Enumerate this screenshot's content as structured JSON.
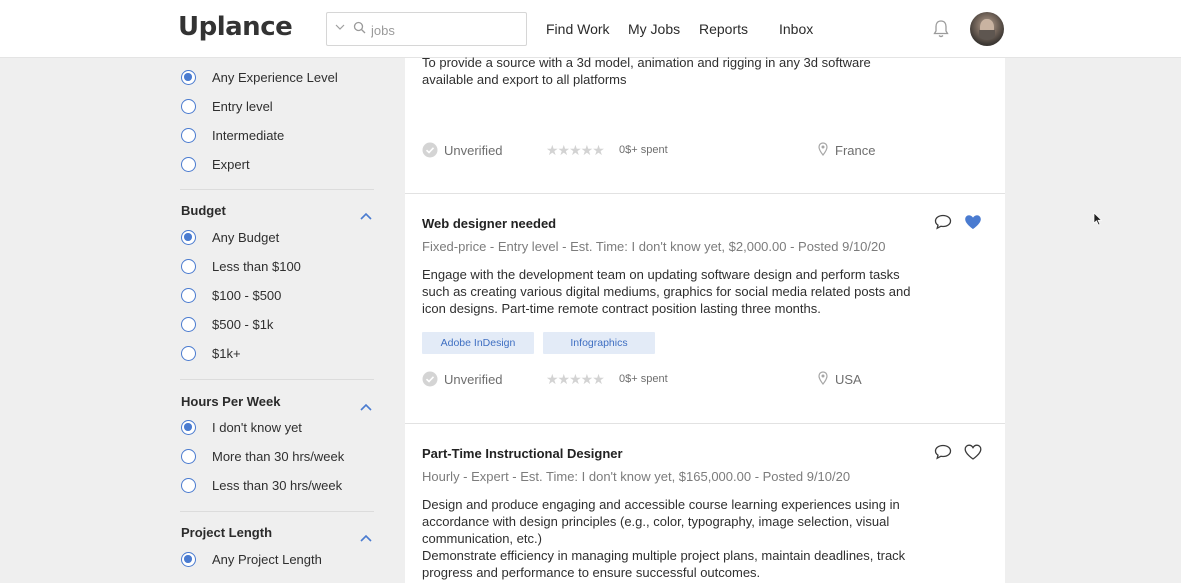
{
  "header": {
    "logo": "Uplance",
    "search": {
      "value": "",
      "placeholder": "jobs"
    },
    "nav": [
      "Find Work",
      "My Jobs",
      "Reports",
      "Inbox"
    ]
  },
  "sidebar": {
    "experience": {
      "options": [
        "Any Experience Level",
        "Entry level",
        "Intermediate",
        "Expert"
      ],
      "selected": 0
    },
    "budget": {
      "title": "Budget",
      "options": [
        "Any Budget",
        "Less than $100",
        "$100 - $500",
        "$500 - $1k",
        "$1k+"
      ],
      "selected": 0
    },
    "hours": {
      "title": "Hours Per Week",
      "options": [
        "I don't know yet",
        "More than 30 hrs/week",
        "Less than 30 hrs/week"
      ],
      "selected": 0
    },
    "length": {
      "title": "Project Length",
      "options": [
        "Any Project Length"
      ],
      "selected": 0
    }
  },
  "jobs": [
    {
      "description": "To provide a source with a 3d model, animation and rigging in any 3d software available and export to all platforms",
      "verification": "Unverified",
      "spent": "0$+ spent",
      "country": "France"
    },
    {
      "title": "Web designer needed",
      "meta": "Fixed-price - Entry level - Est. Time: I don't know yet, $2,000.00 - Posted 9/10/20",
      "description": "Engage with the development team on updating software design and perform tasks such as creating various digital mediums, graphics for social media related posts and icon designs. Part-time remote contract position lasting three months.",
      "tags": [
        "Adobe InDesign",
        "Infographics"
      ],
      "verification": "Unverified",
      "spent": "0$+ spent",
      "country": "USA",
      "favorited": true
    },
    {
      "title": "Part-Time Instructional Designer",
      "meta": "Hourly - Expert - Est. Time: I don't know yet, $165,000.00 - Posted 9/10/20",
      "description_lines": [
        "Design and produce engaging and accessible course learning experiences using in accordance with design principles (e.g., color, typography, image selection, visual communication, etc.)",
        "Demonstrate efficiency in managing multiple project plans, maintain deadlines, track progress and performance to ensure successful outcomes."
      ],
      "favorited": false
    }
  ],
  "colors": {
    "accent": "#4a7bd0",
    "tag_bg": "#e3ebf7",
    "page_bg": "#efefef"
  },
  "icons": [
    "chevron-down-icon",
    "search-icon",
    "bell-icon",
    "avatar",
    "chevron-up-icon",
    "check-circle-icon",
    "star-icon",
    "location-pin-icon",
    "chat-bubble-icon",
    "heart-icon",
    "mouse-cursor"
  ]
}
